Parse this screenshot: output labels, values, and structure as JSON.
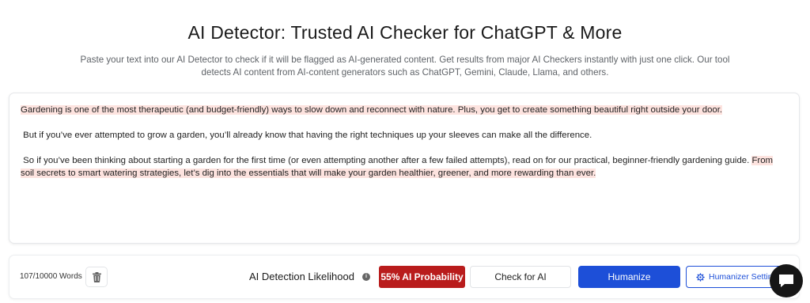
{
  "header": {
    "title": "AI Detector: Trusted AI Checker for ChatGPT & More",
    "subtitle_line1": "Paste your text into our AI Detector to check if it will be flagged as AI-generated content. Get results from major AI Checkers instantly with just one click. Our tool",
    "subtitle_line2": "detects AI content from AI-content generators such as ChatGPT, Gemini, Claude, Llama, and others."
  },
  "editor": {
    "p1_highlighted": "Gardening is one of the most therapeutic (and budget-friendly) ways to slow down and reconnect with nature. Plus, you get to create something beautiful right outside your door.",
    "p2": " But if you’ve ever attempted to grow a garden, you’ll already know that having the right techniques up your sleeves can make all the difference.",
    "p3_plain": " So if you’ve been thinking about starting a garden for the first time (or even attempting another after a few failed attempts), read on for our practical, beginner-friendly gardening guide. ",
    "p3_highlighted": "From soil secrets to smart watering strategies, let’s dig into the essentials that will make your garden healthier, greener, and more rewarding than ever.",
    "highlight_color": "#fde3df"
  },
  "bottom_bar": {
    "word_count": "107/10000 Words",
    "trash_icon": "trash-icon",
    "detection_label": "AI Detection Likelihood",
    "info_icon": "info-icon",
    "probability_badge": "55% AI Probability",
    "probability_color": "#b91c1c",
    "check_button": "Check for AI",
    "humanize_button": "Humanize",
    "humanize_color": "#1d4fd8",
    "settings_button": "Humanizer Settings",
    "settings_icon": "gear-icon"
  },
  "chat_widget": {
    "icon": "chat-icon"
  }
}
